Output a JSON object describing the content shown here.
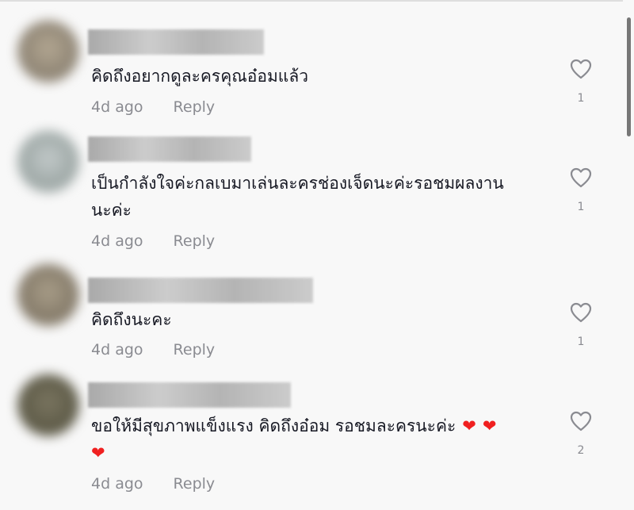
{
  "comments": [
    {
      "text": "คิดถึงอยากดูละครคุณอ๋อมแล้ว",
      "text_line2": "",
      "timestamp": "4d ago",
      "reply_label": "Reply",
      "likes": "1",
      "hearts": 0
    },
    {
      "text": "เป็นกำลังใจค่ะกลเบมาเล่นละครช่องเจ็ดนะค่ะรอชมผลงาน",
      "text_line2": "นะค่ะ",
      "timestamp": "4d ago",
      "reply_label": "Reply",
      "likes": "1",
      "hearts": 0
    },
    {
      "text": "คิดถึงนะคะ",
      "text_line2": "",
      "timestamp": "4d ago",
      "reply_label": "Reply",
      "likes": "1",
      "hearts": 0
    },
    {
      "text": "ขอให้มีสุขภาพแข็งแรง คิดถึงอ๋อม รอชมละครนะค่ะ",
      "text_line2": "",
      "timestamp": "4d ago",
      "reply_label": "Reply",
      "likes": "2",
      "hearts": 3
    }
  ],
  "icons": {
    "like": "heart-outline-icon",
    "emoji": "red-heart-emoji"
  },
  "colors": {
    "background": "#f8f8f8",
    "text": "#161823",
    "secondary_text": "#8a8b91",
    "heart_emoji": "#f02020"
  }
}
